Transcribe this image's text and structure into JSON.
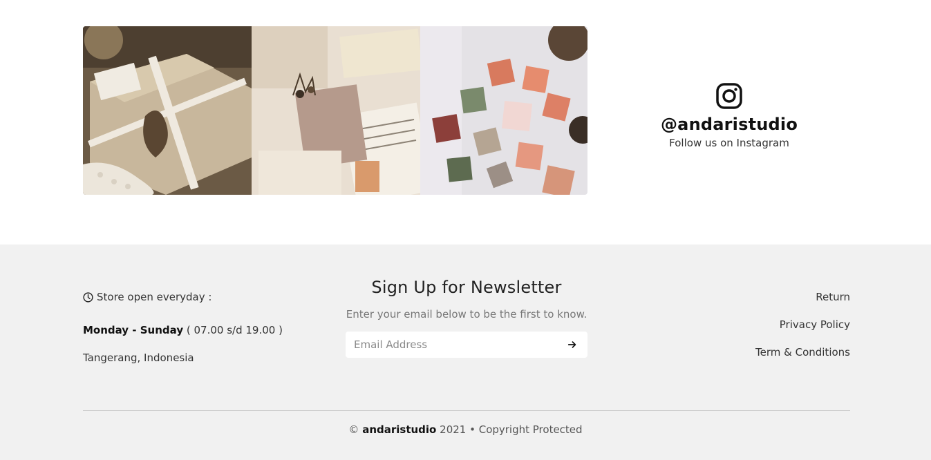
{
  "instagram": {
    "photos": [
      {
        "name": "kraft gift box with lace and dried leaf"
      },
      {
        "name": "vintage ephemera papers with dried flowers"
      },
      {
        "name": "collection of vintage postage stamps"
      }
    ],
    "icon": "instagram-icon",
    "handle": "@andaristudio",
    "subtitle": "Follow us on Instagram"
  },
  "store": {
    "icon": "clock-icon",
    "open_label": "Store open everyday :",
    "days": "Monday - Sunday",
    "hours": "( 07.00 s/d 19.00 )",
    "location": "Tangerang, Indonesia"
  },
  "newsletter": {
    "title": "Sign Up for Newsletter",
    "description": "Enter your email below to be the first to know.",
    "email_placeholder": "Email Address",
    "submit_icon": "arrow-right-icon"
  },
  "links": [
    "Return",
    "Privacy Policy",
    "Term & Conditions"
  ],
  "copyright": {
    "prefix": "©",
    "brand": "andaristudio",
    "suffix": "2021 • Copyright Protected"
  },
  "colors": {
    "footer_bg": "#f1f1f1",
    "text_dark": "#111111",
    "text_muted": "#777777"
  }
}
